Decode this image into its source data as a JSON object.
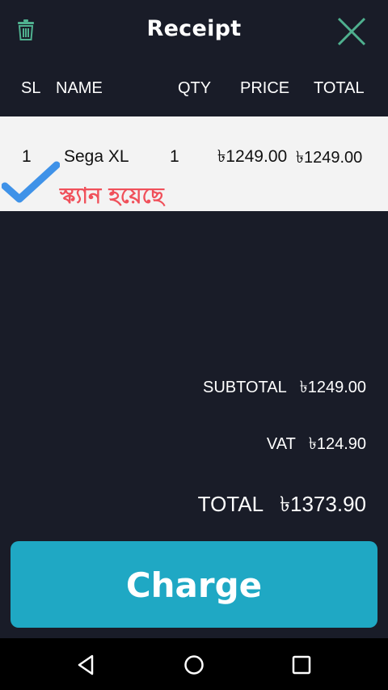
{
  "header": {
    "title": "Receipt"
  },
  "columns": {
    "sl": "SL",
    "name": "NAME",
    "qty": "QTY",
    "price": "PRICE",
    "total": "TOTAL"
  },
  "items": [
    {
      "sl": "1",
      "name": "Sega XL",
      "qty": "1",
      "price": "৳1249.00",
      "total": "৳1249.00",
      "status_text": "স্ক্যান হয়েছে"
    }
  ],
  "summary": {
    "subtotal_label": "SUBTOTAL",
    "subtotal_value": "৳1249.00",
    "vat_label": "VAT",
    "vat_value": "৳124.90",
    "total_label": "TOTAL",
    "total_value": "৳1373.90"
  },
  "charge_button": {
    "label": "Charge"
  },
  "icons": {
    "trash": "trash-icon",
    "close": "close-icon",
    "check": "check-icon",
    "back": "back-icon",
    "home": "home-icon",
    "recents": "recents-icon"
  },
  "colors": {
    "background": "#191c28",
    "row_background": "#f3f3f3",
    "accent_teal": "#1fa8c4",
    "close_green": "#4fb08f",
    "check_blue": "#3f92e8",
    "status_red": "#f0505a"
  }
}
